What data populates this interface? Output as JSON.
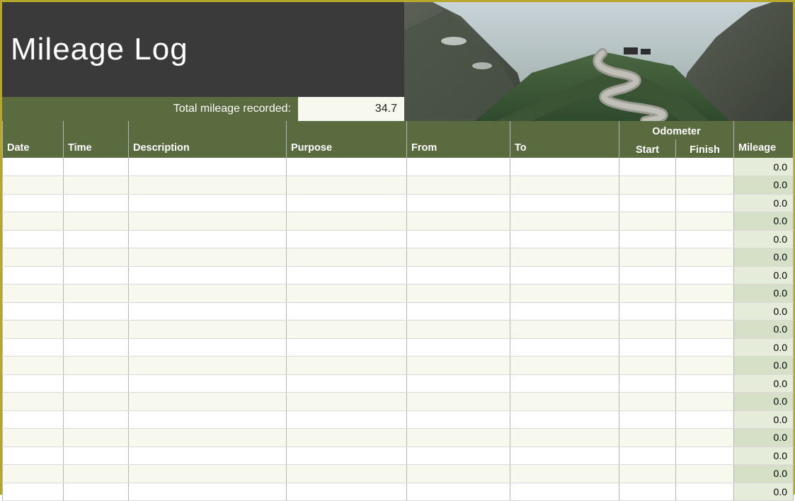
{
  "header": {
    "title": "Mileage Log",
    "total_label": "Total mileage recorded:",
    "total_value": "34.7"
  },
  "columns": {
    "date": "Date",
    "time": "Time",
    "description": "Description",
    "purpose": "Purpose",
    "from": "From",
    "to": "To",
    "odometer_group": "Odometer",
    "odo_start": "Start",
    "odo_finish": "Finish",
    "mileage": "Mileage"
  },
  "rows": [
    {
      "date": "",
      "time": "",
      "description": "",
      "purpose": "",
      "from": "",
      "to": "",
      "ostart": "",
      "ofinish": "",
      "mileage": "0.0"
    },
    {
      "date": "",
      "time": "",
      "description": "",
      "purpose": "",
      "from": "",
      "to": "",
      "ostart": "",
      "ofinish": "",
      "mileage": "0.0"
    },
    {
      "date": "",
      "time": "",
      "description": "",
      "purpose": "",
      "from": "",
      "to": "",
      "ostart": "",
      "ofinish": "",
      "mileage": "0.0"
    },
    {
      "date": "",
      "time": "",
      "description": "",
      "purpose": "",
      "from": "",
      "to": "",
      "ostart": "",
      "ofinish": "",
      "mileage": "0.0"
    },
    {
      "date": "",
      "time": "",
      "description": "",
      "purpose": "",
      "from": "",
      "to": "",
      "ostart": "",
      "ofinish": "",
      "mileage": "0.0"
    },
    {
      "date": "",
      "time": "",
      "description": "",
      "purpose": "",
      "from": "",
      "to": "",
      "ostart": "",
      "ofinish": "",
      "mileage": "0.0"
    },
    {
      "date": "",
      "time": "",
      "description": "",
      "purpose": "",
      "from": "",
      "to": "",
      "ostart": "",
      "ofinish": "",
      "mileage": "0.0"
    },
    {
      "date": "",
      "time": "",
      "description": "",
      "purpose": "",
      "from": "",
      "to": "",
      "ostart": "",
      "ofinish": "",
      "mileage": "0.0"
    },
    {
      "date": "",
      "time": "",
      "description": "",
      "purpose": "",
      "from": "",
      "to": "",
      "ostart": "",
      "ofinish": "",
      "mileage": "0.0"
    },
    {
      "date": "",
      "time": "",
      "description": "",
      "purpose": "",
      "from": "",
      "to": "",
      "ostart": "",
      "ofinish": "",
      "mileage": "0.0"
    },
    {
      "date": "",
      "time": "",
      "description": "",
      "purpose": "",
      "from": "",
      "to": "",
      "ostart": "",
      "ofinish": "",
      "mileage": "0.0"
    },
    {
      "date": "",
      "time": "",
      "description": "",
      "purpose": "",
      "from": "",
      "to": "",
      "ostart": "",
      "ofinish": "",
      "mileage": "0.0"
    },
    {
      "date": "",
      "time": "",
      "description": "",
      "purpose": "",
      "from": "",
      "to": "",
      "ostart": "",
      "ofinish": "",
      "mileage": "0.0"
    },
    {
      "date": "",
      "time": "",
      "description": "",
      "purpose": "",
      "from": "",
      "to": "",
      "ostart": "",
      "ofinish": "",
      "mileage": "0.0"
    },
    {
      "date": "",
      "time": "",
      "description": "",
      "purpose": "",
      "from": "",
      "to": "",
      "ostart": "",
      "ofinish": "",
      "mileage": "0.0"
    },
    {
      "date": "",
      "time": "",
      "description": "",
      "purpose": "",
      "from": "",
      "to": "",
      "ostart": "",
      "ofinish": "",
      "mileage": "0.0"
    },
    {
      "date": "",
      "time": "",
      "description": "",
      "purpose": "",
      "from": "",
      "to": "",
      "ostart": "",
      "ofinish": "",
      "mileage": "0.0"
    },
    {
      "date": "",
      "time": "",
      "description": "",
      "purpose": "",
      "from": "",
      "to": "",
      "ostart": "",
      "ofinish": "",
      "mileage": "0.0"
    },
    {
      "date": "",
      "time": "",
      "description": "",
      "purpose": "",
      "from": "",
      "to": "",
      "ostart": "",
      "ofinish": "",
      "mileage": "0.0"
    }
  ]
}
